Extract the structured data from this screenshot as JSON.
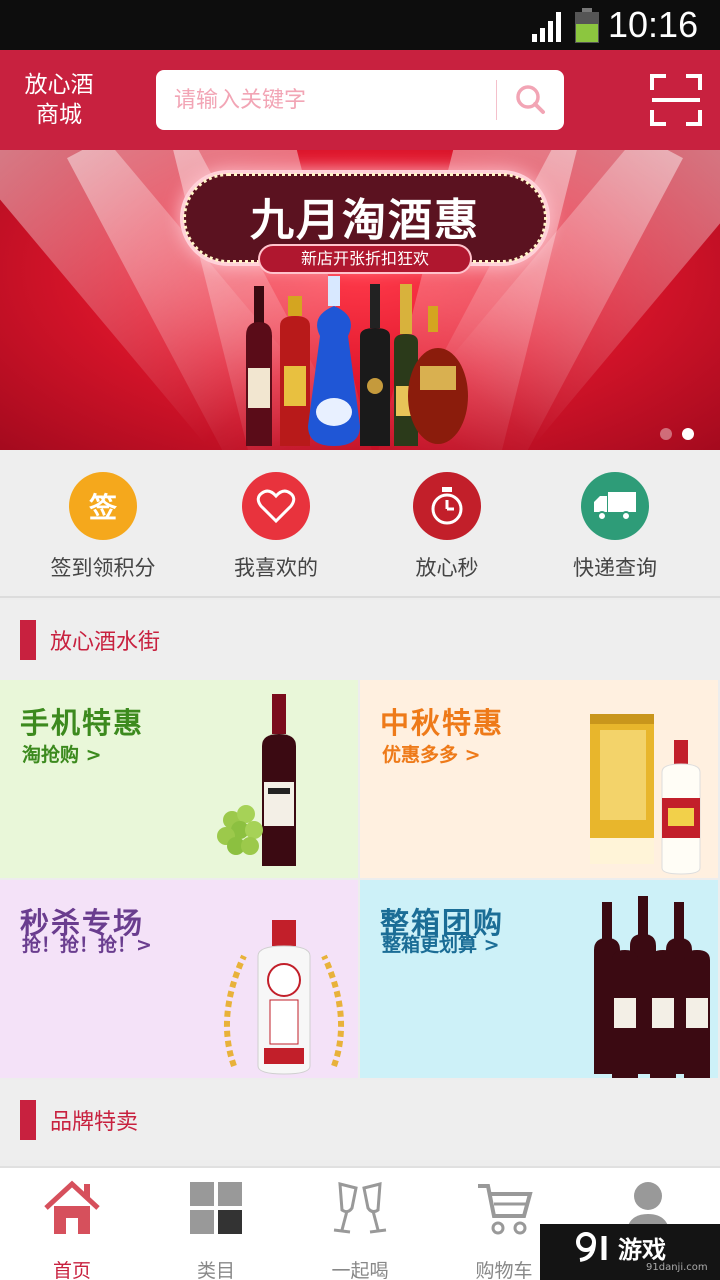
{
  "status_bar": {
    "time": "10:16"
  },
  "header": {
    "brand": "放心酒\n商城",
    "search_placeholder": "请输入关键字"
  },
  "banner": {
    "title": "九月淘酒惠",
    "subtitle": "新店开张折扣狂欢",
    "active_slide": 2,
    "slide_count": 2
  },
  "quick_actions": [
    {
      "label": "签到领积分",
      "icon": "sign-in-icon",
      "glyph": "签",
      "color": "#f5a81c"
    },
    {
      "label": "我喜欢的",
      "icon": "heart-icon",
      "color": "#e8333d"
    },
    {
      "label": "放心秒",
      "icon": "stopwatch-icon",
      "color": "#c21f2a"
    },
    {
      "label": "快递查询",
      "icon": "truck-icon",
      "color": "#2e9c78"
    }
  ],
  "section1": {
    "title": "放心酒水街"
  },
  "promos": [
    {
      "title": "手机特惠",
      "subtitle": "淘抢购 >",
      "bg": "#e9f7d9",
      "title_color": "#3c8a1e",
      "sub_color": "#3c8a1e"
    },
    {
      "title": "中秋特惠",
      "subtitle": "优惠多多 >",
      "bg": "#fff0e0",
      "title_color": "#ee7a19",
      "sub_color": "#ee7a19"
    },
    {
      "title": "秒杀专场",
      "subtitle": "抢！抢！抢！>",
      "bg": "#f4e2f8",
      "title_color": "#6a3d8f",
      "sub_color": "#6a3d8f"
    },
    {
      "title": "整箱团购",
      "subtitle": "整箱更划算 >",
      "bg": "#cdf1f8",
      "title_color": "#1b6d96",
      "sub_color": "#1b6d96"
    }
  ],
  "section2": {
    "title": "品牌特卖"
  },
  "bottom_nav": [
    {
      "label": "首页",
      "icon": "home-icon",
      "active": true
    },
    {
      "label": "类目",
      "icon": "category-grid-icon",
      "active": false
    },
    {
      "label": "一起喝",
      "icon": "cheers-glasses-icon",
      "active": false
    },
    {
      "label": "购物车",
      "icon": "cart-icon",
      "active": false
    },
    {
      "label": "",
      "icon": "user-icon",
      "active": false
    }
  ],
  "watermark": {
    "logo": "游戏",
    "url": "91danji.com"
  },
  "colors": {
    "brand_red": "#c8213f"
  }
}
